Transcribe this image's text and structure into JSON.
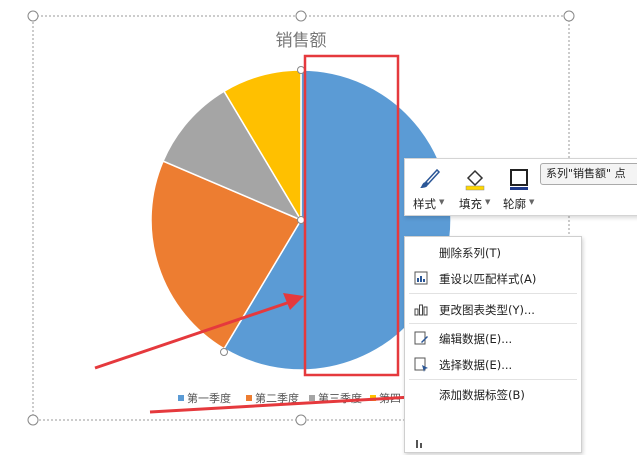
{
  "chart_data": {
    "type": "pie",
    "title": "销售额",
    "categories": [
      "第一季度",
      "第二季度",
      "第三季度",
      "第四季度"
    ],
    "values": [
      8.2,
      3.2,
      1.4,
      1.2
    ],
    "colors": [
      "#5b9bd5",
      "#ed7d31",
      "#a5a5a5",
      "#ffc000"
    ],
    "legend_position": "bottom",
    "legend_visible_text": [
      "第一季度",
      "第二季度",
      "第三季度",
      "第四"
    ]
  },
  "mini_toolbar": {
    "style_label": "样式",
    "fill_label": "填充",
    "outline_label": "轮廓",
    "series_selector": "系列\"销售额\" 点"
  },
  "context_menu": {
    "items": [
      {
        "label": "删除系列(T)",
        "icon": "none"
      },
      {
        "label": "重设以匹配样式(A)",
        "icon": "reset-style-icon"
      },
      {
        "label": "更改图表类型(Y)...",
        "icon": "chart-type-icon"
      },
      {
        "label": "编辑数据(E)...",
        "icon": "edit-data-icon"
      },
      {
        "label": "选择数据(E)...",
        "icon": "select-data-icon"
      },
      {
        "label": "添加数据标签(B)",
        "icon": "none"
      }
    ]
  },
  "colors": {
    "highlight_box": "#e5393d",
    "arrow": "#e5393d",
    "selection_handle": "#888888"
  }
}
